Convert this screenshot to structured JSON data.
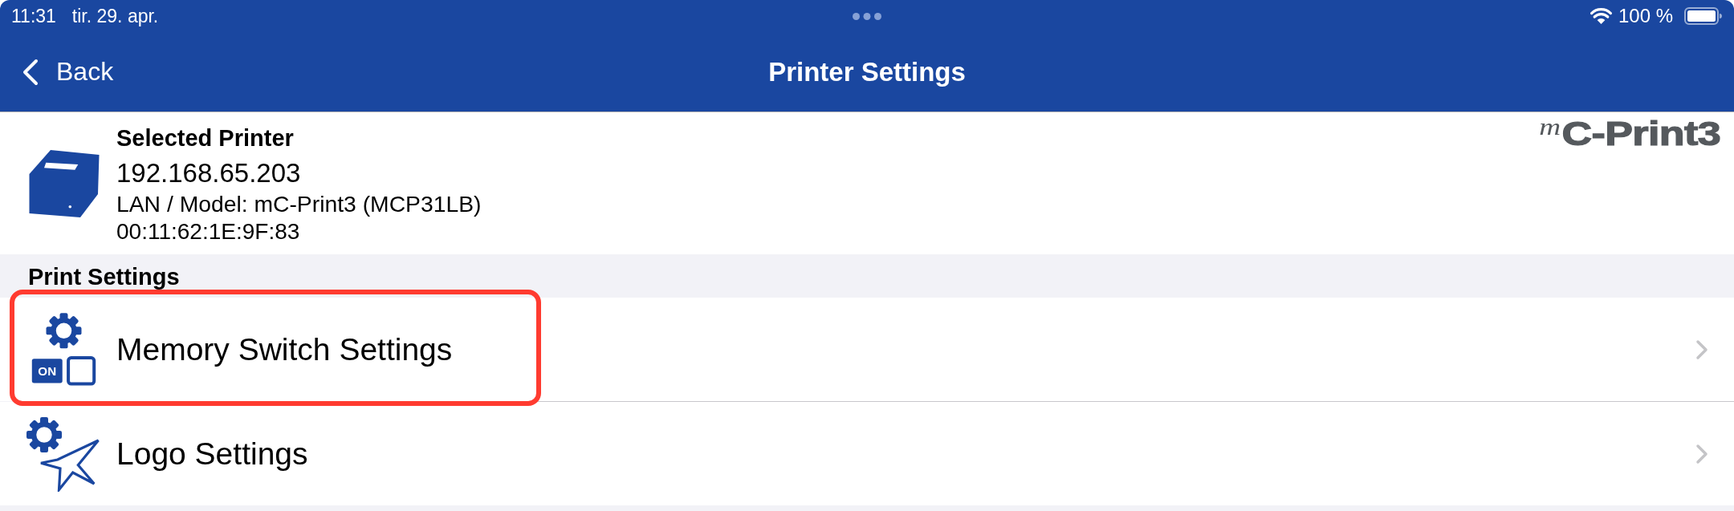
{
  "status_bar": {
    "time": "11:31",
    "date": "tir. 29. apr.",
    "battery_percent": "100 %"
  },
  "nav_bar": {
    "back": "Back",
    "title": "Printer Settings"
  },
  "printer": {
    "heading": "Selected Printer",
    "address": "192.168.65.203",
    "model": "LAN / Model: mC-Print3 (MCP31LB)",
    "mac": "00:11:62:1E:9F:83",
    "logo": "$^{m}$C-Print3"
  },
  "sections": [
    {
      "title": "Print Settings",
      "items": [
        {
          "kind": "memory-switch",
          "label": "Memory Switch Settings",
          "icon_text": "ON",
          "highlighted": true
        },
        {
          "kind": "logo",
          "label": "Logo Settings",
          "highlighted": false
        }
      ]
    }
  ]
}
